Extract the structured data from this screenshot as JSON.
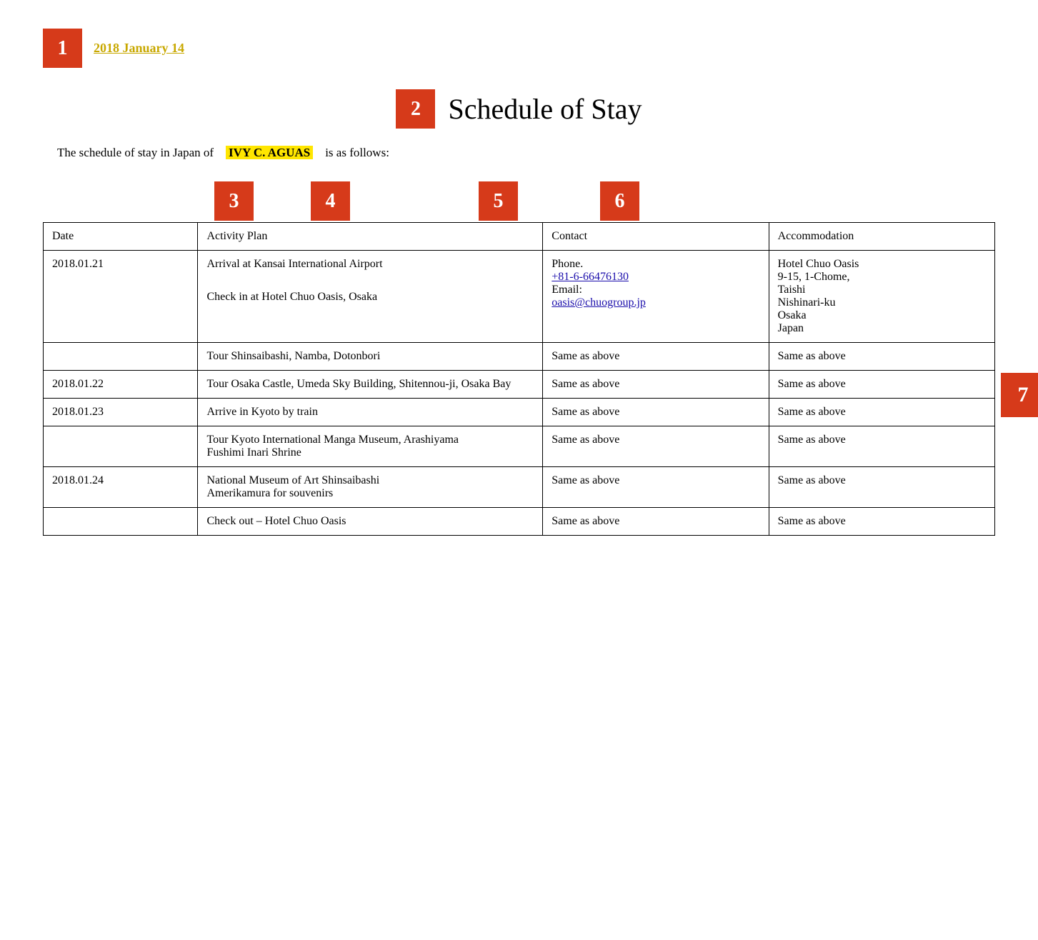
{
  "header": {
    "badge1": "1",
    "date": "2018 January 14",
    "badge2": "2",
    "title": "Schedule of Stay",
    "intro_pre": "The schedule of stay in Japan of",
    "name": "IVY C. AGUAS",
    "intro_post": "is as follows:"
  },
  "column_badges": {
    "b3": "3",
    "b4": "4",
    "b5": "5",
    "b6": "6"
  },
  "table": {
    "headers": {
      "date": "Date",
      "activity": "Activity Plan",
      "contact": "Contact",
      "accommodation": "Accommodation"
    },
    "rows": [
      {
        "date": "2018.01.21",
        "activity": "Arrival at Kansai International Airport\n\nCheck in at Hotel Chuo Oasis, Osaka",
        "contact_type": "full",
        "contact_phone": "Phone.",
        "contact_phone_num": "+81-6-66476130",
        "contact_email_label": "Email:",
        "contact_email": "oasis@chuogroup.jp",
        "accommodation_type": "full",
        "accommodation": "Hotel Chuo Oasis\n9-15, 1-Chome,\nTaishi\nNishinari-ku\nOsaka\nJapan"
      },
      {
        "date": "",
        "activity": "Tour Shinsaibashi, Namba, Dotonbori",
        "contact_type": "same",
        "contact": "Same  as above",
        "accommodation_type": "same",
        "accommodation": "Same as above"
      },
      {
        "date": "2018.01.22",
        "activity": "Tour Osaka Castle, Umeda Sky Building, Shitennou-ji, Osaka Bay",
        "contact_type": "same",
        "contact": "Same as above",
        "accommodation_type": "same",
        "accommodation": "Same as above"
      },
      {
        "date": "2018.01.23",
        "activity": "Arrive in Kyoto by train",
        "contact_type": "same",
        "contact": "Same as above",
        "accommodation_type": "same",
        "accommodation": "Same as above"
      },
      {
        "date": "",
        "activity": "Tour Kyoto International Manga Museum, Arashiyama\nFushimi Inari Shrine",
        "contact_type": "same",
        "contact": "Same as above",
        "accommodation_type": "same",
        "accommodation": "Same as above"
      },
      {
        "date": "2018.01.24",
        "activity": "National Museum of Art Shinsaibashi\nAmerikamura for souvenirs",
        "contact_type": "same",
        "contact": "Same as above",
        "accommodation_type": "same",
        "accommodation": "Same as above"
      },
      {
        "date": "",
        "activity": "Check out – Hotel Chuo Oasis",
        "contact_type": "same",
        "contact": "Same as above",
        "accommodation_type": "same",
        "accommodation": "Same as above"
      }
    ]
  },
  "badge7": "7"
}
